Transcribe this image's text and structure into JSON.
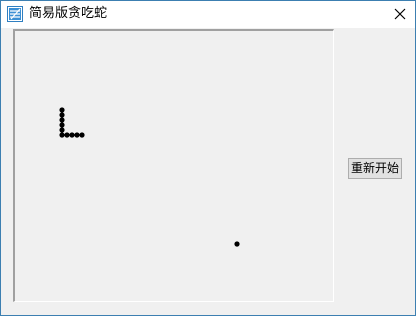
{
  "window": {
    "title": "简易版贪吃蛇"
  },
  "controls": {
    "restart_label": "重新开始"
  },
  "icons": {
    "app": "app-icon",
    "close": "close-icon"
  },
  "colors": {
    "frame_border": "#3c7fb1",
    "background": "#f0f0f0",
    "snake": "#000000",
    "food": "#000000"
  }
}
